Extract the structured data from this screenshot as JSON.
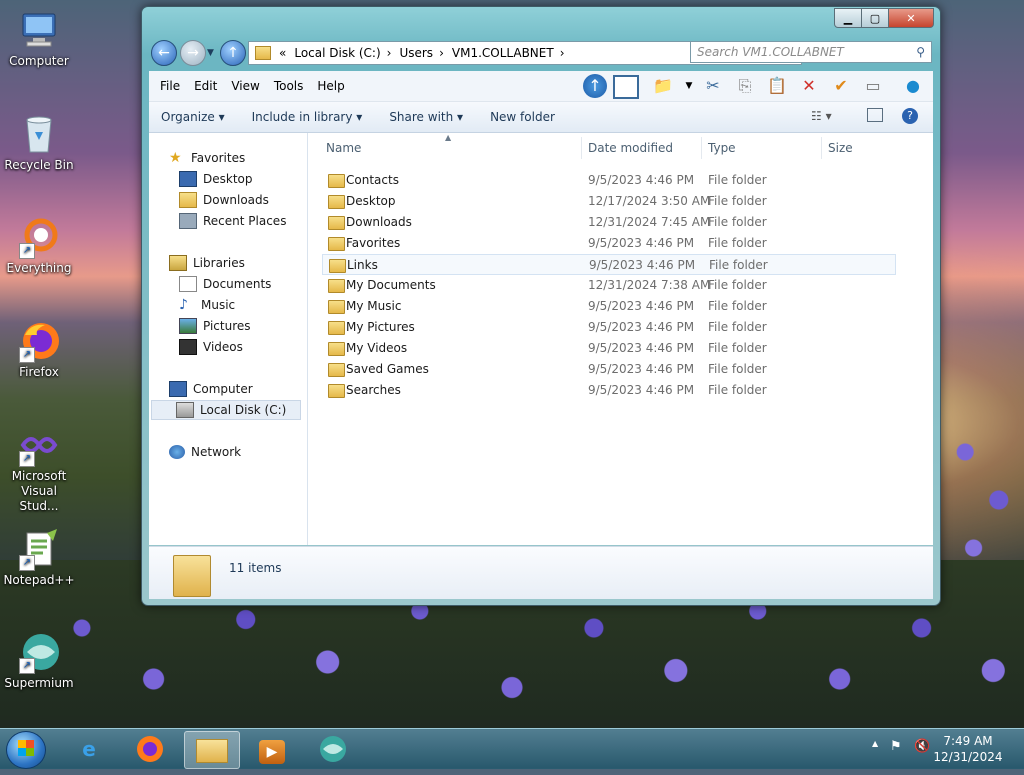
{
  "desktop": {
    "icons": [
      {
        "label": "Computer",
        "glyph": "🖥"
      },
      {
        "label": "Recycle Bin",
        "glyph": "🗑"
      },
      {
        "label": "Everything",
        "glyph": "◯"
      },
      {
        "label": "Firefox",
        "glyph": "🦊"
      },
      {
        "label": "Microsoft Visual Stud...",
        "glyph": "∞"
      },
      {
        "label": "Notepad++",
        "glyph": "📝"
      },
      {
        "label": "Supermium",
        "glyph": "◐"
      }
    ]
  },
  "window": {
    "controls": {
      "minimize": "▁",
      "maximize": "▢",
      "close": "✕"
    },
    "address": {
      "chevron": "«",
      "crumbs": [
        "Local Disk (C:)",
        "Users",
        "VM1.COLLABNET"
      ]
    },
    "search_placeholder": "Search VM1.COLLABNET",
    "menu": [
      "File",
      "Edit",
      "View",
      "Tools",
      "Help"
    ],
    "toolbar": {
      "organize": "Organize ▾",
      "include": "Include in library ▾",
      "share": "Share with ▾",
      "new_folder": "New folder"
    },
    "nav": {
      "favorites": "Favorites",
      "fav_items": [
        "Desktop",
        "Downloads",
        "Recent Places"
      ],
      "libraries": "Libraries",
      "lib_items": [
        "Documents",
        "Music",
        "Pictures",
        "Videos"
      ],
      "computer": "Computer",
      "computer_items": [
        "Local Disk (C:)"
      ],
      "network": "Network"
    },
    "columns": [
      "Name",
      "Date modified",
      "Type",
      "Size"
    ],
    "files": [
      {
        "name": "Contacts",
        "date": "9/5/2023 4:46 PM",
        "type": "File folder"
      },
      {
        "name": "Desktop",
        "date": "12/17/2024 3:50 AM",
        "type": "File folder"
      },
      {
        "name": "Downloads",
        "date": "12/31/2024 7:45 AM",
        "type": "File folder"
      },
      {
        "name": "Favorites",
        "date": "9/5/2023 4:46 PM",
        "type": "File folder"
      },
      {
        "name": "Links",
        "date": "9/5/2023 4:46 PM",
        "type": "File folder"
      },
      {
        "name": "My Documents",
        "date": "12/31/2024 7:38 AM",
        "type": "File folder"
      },
      {
        "name": "My Music",
        "date": "9/5/2023 4:46 PM",
        "type": "File folder"
      },
      {
        "name": "My Pictures",
        "date": "9/5/2023 4:46 PM",
        "type": "File folder"
      },
      {
        "name": "My Videos",
        "date": "9/5/2023 4:46 PM",
        "type": "File folder"
      },
      {
        "name": "Saved Games",
        "date": "9/5/2023 4:46 PM",
        "type": "File folder"
      },
      {
        "name": "Searches",
        "date": "9/5/2023 4:46 PM",
        "type": "File folder"
      }
    ],
    "status": "11 items"
  },
  "taskbar": {
    "items": [
      "ie",
      "firefox",
      "explorer",
      "media",
      "supermium"
    ],
    "time": "7:49 AM",
    "date": "12/31/2024"
  }
}
